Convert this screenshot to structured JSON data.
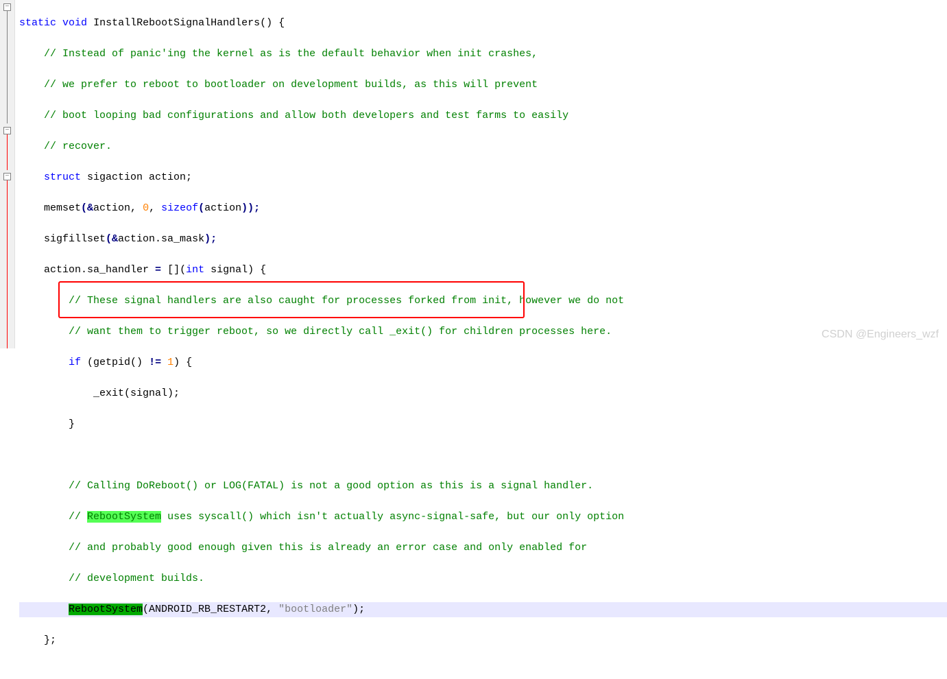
{
  "code": {
    "l1_static": "static",
    "l1_void": "void",
    "l1_func": "InstallRebootSignalHandlers",
    "l1_end": "() {",
    "l2": "// Instead of panic'ing the kernel as is the default behavior when init crashes,",
    "l3": "// we prefer to reboot to bootloader on development builds, as this will prevent",
    "l4": "// boot looping bad configurations and allow both developers and test farms to easily",
    "l5": "// recover.",
    "l6_struct": "struct",
    "l6_rest": " sigaction action;",
    "l7_a": "memset",
    "l7_b": "(&",
    "l7_c": "action, ",
    "l7_num": "0",
    "l7_d": ", ",
    "l7_sizeof": "sizeof",
    "l7_e": "(",
    "l7_f": "action",
    "l7_g": "));",
    "l8_a": "sigfillset",
    "l8_b": "(&",
    "l8_c": "action.sa_mask",
    "l8_d": ");",
    "l9_a": "action.sa_handler ",
    "l9_eq": "=",
    "l9_b": " [](",
    "l9_int": "int",
    "l9_c": " signal) {",
    "l10": "// These signal handlers are also caught for processes forked from init, however we do not",
    "l11": "// want them to trigger reboot, so we directly call _exit() for children processes here.",
    "l12_if": "if",
    "l12_a": " (getpid() ",
    "l12_ne": "!=",
    "l12_sp": " ",
    "l12_one": "1",
    "l12_b": ") {",
    "l13_a": "_exit(signal);",
    "l14": "}",
    "l16": "// Calling DoReboot() or LOG(FATAL) is not a good option as this is a signal handler.",
    "l17_a": "// ",
    "l17_reboot": "RebootSystem",
    "l17_b": " uses syscall() which isn't actually async-signal-safe, but our only option",
    "l18": "// and probably good enough given this is already an error case and only enabled for",
    "l19": "// development builds.",
    "l20_reboot": "RebootSystem",
    "l20_a": "(ANDROID_RB_RESTART2, ",
    "l20_str": "\"bootloader\"",
    "l20_b": ");",
    "l21": "};"
  },
  "watermark": "CSDN @Engineers_wzf"
}
